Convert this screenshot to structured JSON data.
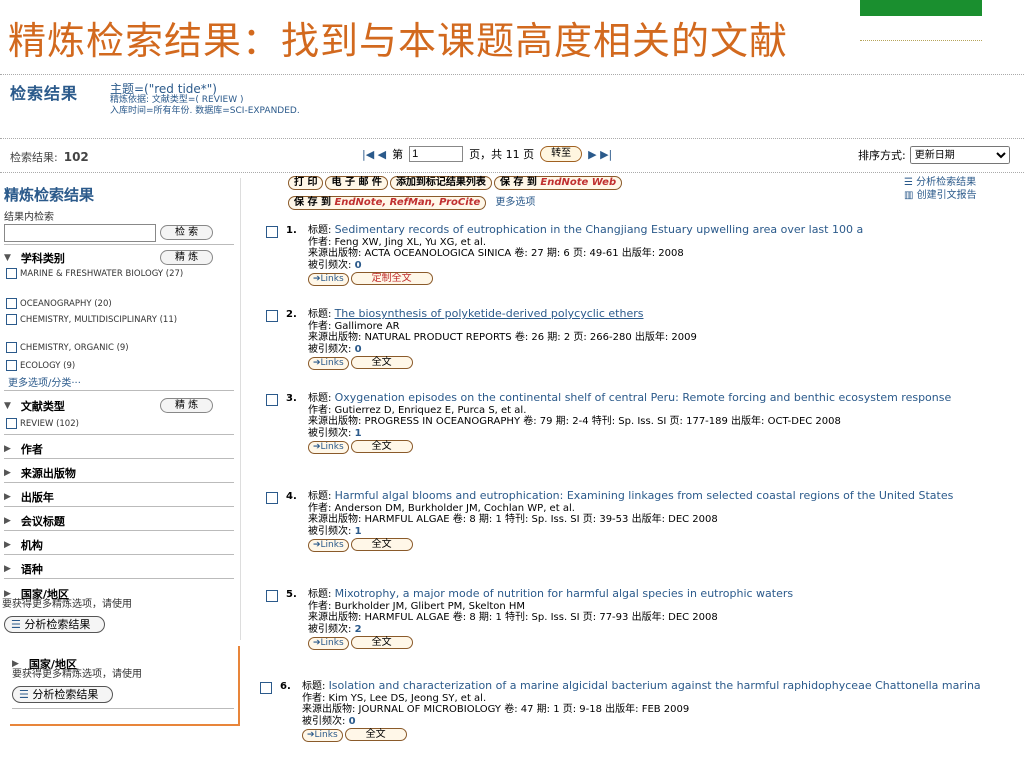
{
  "slide": {
    "title": "精炼检索结果：找到与本课题高度相关的文献"
  },
  "query": {
    "heading": "检索结果",
    "topic": "主题=(\"red tide*\")",
    "refine": "精炼依据: 文献类型=( REVIEW )",
    "period": "入库时间=所有年份. 数据库=SCI-EXPANDED."
  },
  "results_bar": {
    "count_label": "检索结果:",
    "count": "102",
    "prev_icons": "|◀ ◀",
    "page_prefix": "第",
    "page_value": "1",
    "page_suffix": "页，共 11 页",
    "goto": "转至",
    "next_icons": "▶ ▶|",
    "sort_label": "排序方式:",
    "sort_value": "更新日期"
  },
  "sidebar": {
    "title": "精炼检索结果",
    "within": "结果内检索",
    "search_btn": "检 索",
    "subject_label": "学科类别",
    "refine_btn": "精 炼",
    "subjects": [
      "MARINE & FRESHWATER BIOLOGY (27)",
      "OCEANOGRAPHY (20)",
      "CHEMISTRY, MULTIDISCIPLINARY (11)",
      "CHEMISTRY, ORGANIC (9)",
      "ECOLOGY (9)"
    ],
    "more": "更多选项/分类···",
    "doctype_label": "文献类型",
    "doctype_refine": "精 炼",
    "doctype_opt": "REVIEW (102)",
    "facets": [
      "作者",
      "来源出版物",
      "出版年",
      "会议标题",
      "机构",
      "语种",
      "国家/地区"
    ],
    "note": "要获得更多精炼选项，请使用",
    "analyze": "分析检索结果"
  },
  "popup": {
    "facet": "国家/地区",
    "note": "要获得更多精炼选项，请使用",
    "analyze": "分析检索结果"
  },
  "toolbar": {
    "print": "打 印",
    "email": "电 子 邮 件",
    "add_marked": "添加到标记结果列表",
    "save_to": "保 存 到",
    "endnote_web": "EndNote Web",
    "save_to2": "保 存 到",
    "endnote": "EndNote, RefMan, ProCite",
    "more": "更多选项",
    "analyze_link": "分析检索结果",
    "citation_link": "创建引文报告"
  },
  "records": [
    {
      "num": "1.",
      "title": "Sedimentary records of eutrophication in the Changjiang Estuary upwelling area over last 100 a",
      "authors": "作者: Feng XW, Jing XL, Yu XG, et al.",
      "source": "来源出版物: ACTA OCEANOLOGICA SINICA   卷: 27   期: 6   页: 49-61   出版年: 2008",
      "cited_label": "被引频次:",
      "cited": "0",
      "links": "Links",
      "fulltext": "定制全文"
    },
    {
      "num": "2.",
      "title": "The biosynthesis of polyketide-derived polycyclic ethers",
      "authors": "作者: Gallimore AR",
      "source": "来源出版物: NATURAL PRODUCT REPORTS   卷: 26   期: 2   页: 266-280   出版年: 2009",
      "cited_label": "被引频次:",
      "cited": "0",
      "links": "Links",
      "fulltext": "全文"
    },
    {
      "num": "3.",
      "title": "Oxygenation episodes on the continental shelf of central Peru: Remote forcing and benthic ecosystem response",
      "authors": "作者: Gutierrez D, Enriquez E, Purca S, et al.",
      "source": "来源出版物: PROGRESS IN OCEANOGRAPHY   卷: 79   期: 2-4   特刊: Sp. Iss. SI   页: 177-189   出版年: OCT-DEC 2008",
      "cited_label": "被引频次:",
      "cited": "1",
      "links": "Links",
      "fulltext": "全文"
    },
    {
      "num": "4.",
      "title": "Harmful algal blooms and eutrophication: Examining linkages from selected coastal regions of the United States",
      "authors": "作者: Anderson DM, Burkholder JM, Cochlan WP, et al.",
      "source": "来源出版物: HARMFUL ALGAE   卷: 8   期: 1   特刊: Sp. Iss. SI   页: 39-53   出版年: DEC 2008",
      "cited_label": "被引频次:",
      "cited": "1",
      "links": "Links",
      "fulltext": "全文"
    },
    {
      "num": "5.",
      "title": "Mixotrophy, a major mode of nutrition for harmful algal species in eutrophic waters",
      "authors": "作者: Burkholder JM, Glibert PM, Skelton HM",
      "source": "来源出版物: HARMFUL ALGAE   卷: 8   期: 1   特刊: Sp. Iss. SI   页: 77-93   出版年: DEC 2008",
      "cited_label": "被引频次:",
      "cited": "2",
      "links": "Links",
      "fulltext": "全文"
    },
    {
      "num": "6.",
      "title": "Isolation and characterization of a marine algicidal bacterium against the harmful raphidophyceae Chattonella marina",
      "authors": "作者: Kim YS, Lee DS, Jeong SY, et al.",
      "source": "来源出版物: JOURNAL OF MICROBIOLOGY   卷: 47   期: 1   页: 9-18   出版年: FEB 2009",
      "cited_label": "被引频次:",
      "cited": "0",
      "links": "Links",
      "fulltext": "全文"
    }
  ],
  "colors": {
    "title": "#d2691e",
    "accent": "#2b5a8b",
    "green": "#1a8f2f",
    "orange": "#e8853a"
  }
}
